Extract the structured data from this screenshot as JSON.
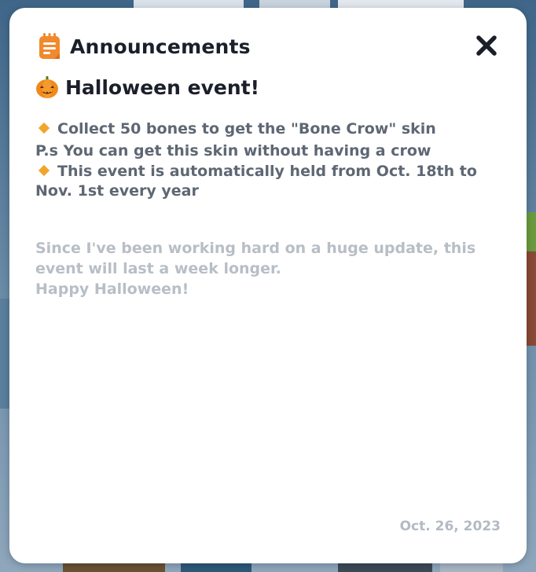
{
  "dialog": {
    "title": "Announcements",
    "close_icon": "close-icon",
    "header_icon": "notepad-icon"
  },
  "event": {
    "icon": "pumpkin-icon",
    "title": "Halloween event!",
    "lines": [
      "Collect 50 bones to get the \"Bone Crow\" skin",
      "P.s You can get this skin without having a crow",
      "This event is automatically held from Oct. 18th to Nov. 1st every year"
    ],
    "note_lines": [
      "Since I've been working hard on a huge update, this event will last a week longer.",
      "Happy Halloween!"
    ],
    "date": "Oct. 26, 2023"
  },
  "colors": {
    "accent_orange": "#f2a52a",
    "title_text": "#1b1f2a",
    "body_text": "#5e6773",
    "muted_text": "#b8bec6"
  }
}
